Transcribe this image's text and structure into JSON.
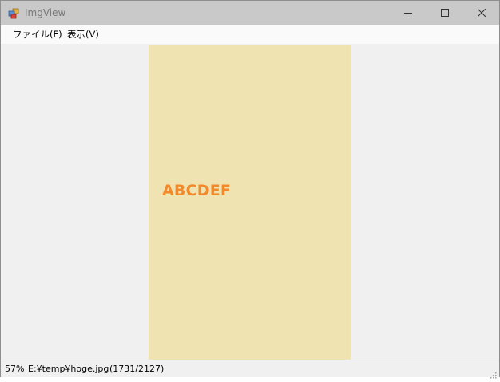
{
  "window": {
    "title": "ImgView",
    "app_icon": "imgview-app-icon",
    "controls": {
      "minimize_icon": "minimize-icon",
      "maximize_icon": "maximize-icon",
      "close_icon": "close-icon"
    }
  },
  "menu": {
    "items": [
      {
        "label": "ファイル(F)"
      },
      {
        "label": "表示(V)"
      }
    ]
  },
  "image": {
    "text": "ABCDEF",
    "background": "#efe3b1",
    "text_color": "#f28a2b"
  },
  "status": {
    "zoom": "57%",
    "path": "E:¥temp¥hoge.jpg",
    "dimensions": "(1731/2127)",
    "grip_icon": "resize-grip-icon"
  },
  "colors": {
    "titlebar": "#c9c9c9",
    "menubar": "#fafafa",
    "client": "#f0f0f0"
  }
}
